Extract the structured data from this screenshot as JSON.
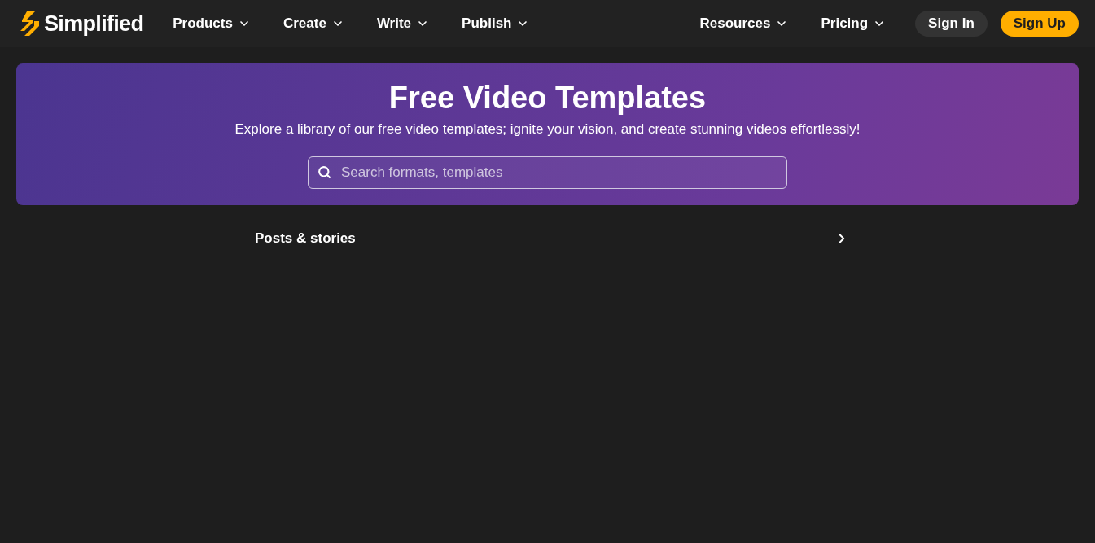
{
  "nav": {
    "logo": "Simplified",
    "menus": [
      {
        "label": "Products"
      },
      {
        "label": "Create"
      },
      {
        "label": "Write"
      },
      {
        "label": "Publish"
      }
    ],
    "right_menus": [
      {
        "label": "Resources"
      },
      {
        "label": "Pricing"
      }
    ],
    "buttons": [
      {
        "label": "Sign In",
        "kind": "secondary"
      },
      {
        "label": "Sign Up",
        "kind": "primary"
      }
    ]
  },
  "hero": {
    "title": "Free Video Templates",
    "subtitle": "Explore a library of our free video templates; ignite your vision, and create stunning videos effortlessly!",
    "search": {
      "placeholder": "Search formats, templates"
    }
  },
  "category": {
    "label": "Posts & stories"
  }
}
